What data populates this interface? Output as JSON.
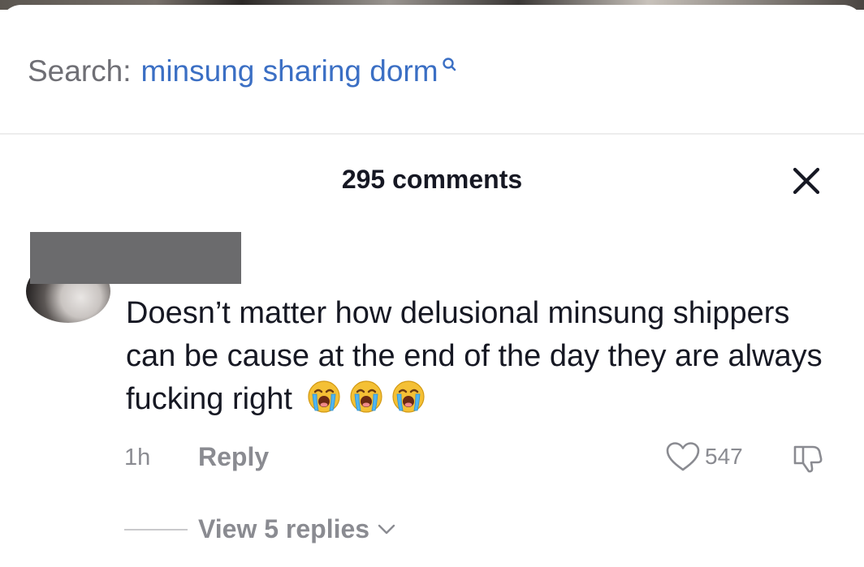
{
  "search": {
    "prefix": "Search:",
    "query": "minsung sharing dorm"
  },
  "comments_panel": {
    "title": "295 comments"
  },
  "comment": {
    "text": "Doesn’t matter how delusional minsung shippers can be cause at the end of the day they are always fucking right",
    "emojis": [
      "loudly-crying-face",
      "loudly-crying-face",
      "loudly-crying-face"
    ],
    "time": "1h",
    "reply_label": "Reply",
    "like_count": "547",
    "view_replies_label": "View 5 replies"
  },
  "colors": {
    "search_query": "#3b6fc4",
    "muted_text": "#8a8b91",
    "primary_text": "#161823"
  }
}
